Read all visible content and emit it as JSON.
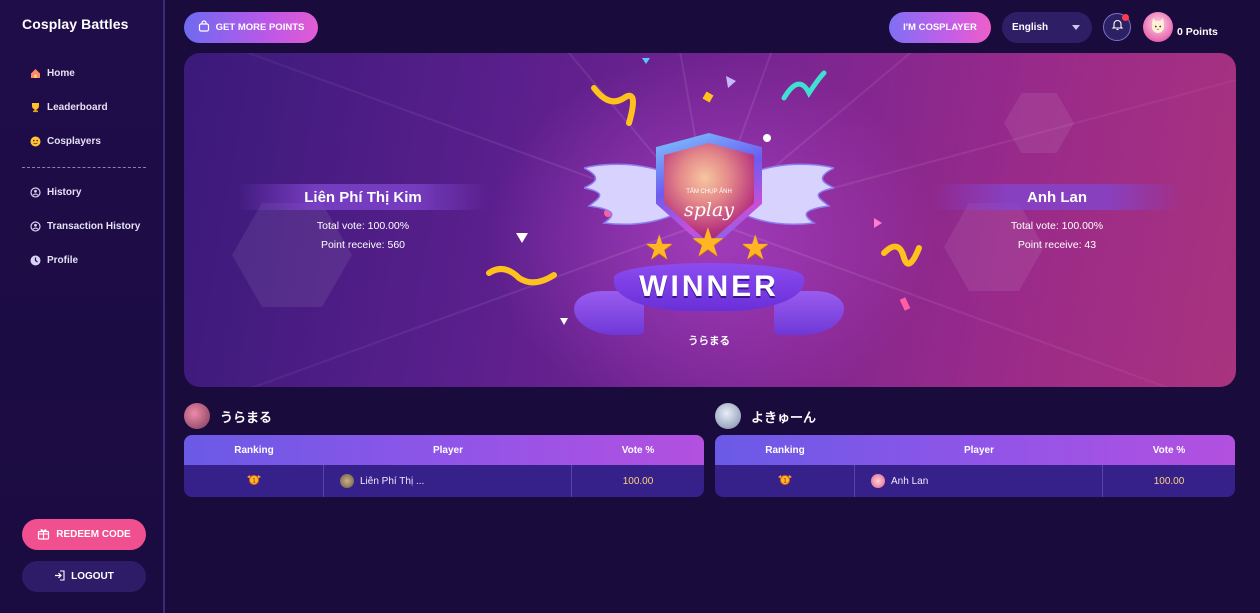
{
  "app": {
    "brand": "Cosplay Battles"
  },
  "sidebar": {
    "items": [
      {
        "label": "Home",
        "icon": "home-icon"
      },
      {
        "label": "Leaderboard",
        "icon": "trophy-icon"
      },
      {
        "label": "Cosplayers",
        "icon": "cosplayer-icon"
      },
      {
        "label": "History",
        "icon": "history-icon"
      },
      {
        "label": "Transaction History",
        "icon": "transaction-icon"
      },
      {
        "label": "Profile",
        "icon": "profile-icon"
      }
    ],
    "redeem_label": "REDEEM CODE",
    "logout_label": "LOGOUT"
  },
  "topbar": {
    "get_points_label": "GET MORE POINTS",
    "cosplayer_label": "I'M COSPLAYER",
    "language": "English",
    "points": "0 Points"
  },
  "hero": {
    "left": {
      "name": "Liên Phí Thị Kim",
      "total_vote": "Total vote: 100.00%",
      "point_receive": "Point receive: 560"
    },
    "right": {
      "name": "Anh Lan",
      "total_vote": "Total vote: 100.00%",
      "point_receive": "Point receive: 43"
    },
    "badge_small_text": "TẤM CHỤP ẢNH",
    "badge_script_text": "splay",
    "winner_label": "WINNER",
    "winner_name": "うらまる"
  },
  "groups": [
    {
      "name": "うらまる",
      "headers": {
        "ranking": "Ranking",
        "player": "Player",
        "vote": "Vote %"
      },
      "rows": [
        {
          "player": "Liên Phí Thị ...",
          "vote": "100.00"
        }
      ]
    },
    {
      "name": "よきゅーん",
      "headers": {
        "ranking": "Ranking",
        "player": "Player",
        "vote": "Vote %"
      },
      "rows": [
        {
          "player": "Anh Lan",
          "vote": "100.00"
        }
      ]
    }
  ],
  "colors": {
    "background": "#1a0b3d",
    "accent_pink": "#f0508f",
    "vote_value": "#ffd278"
  }
}
